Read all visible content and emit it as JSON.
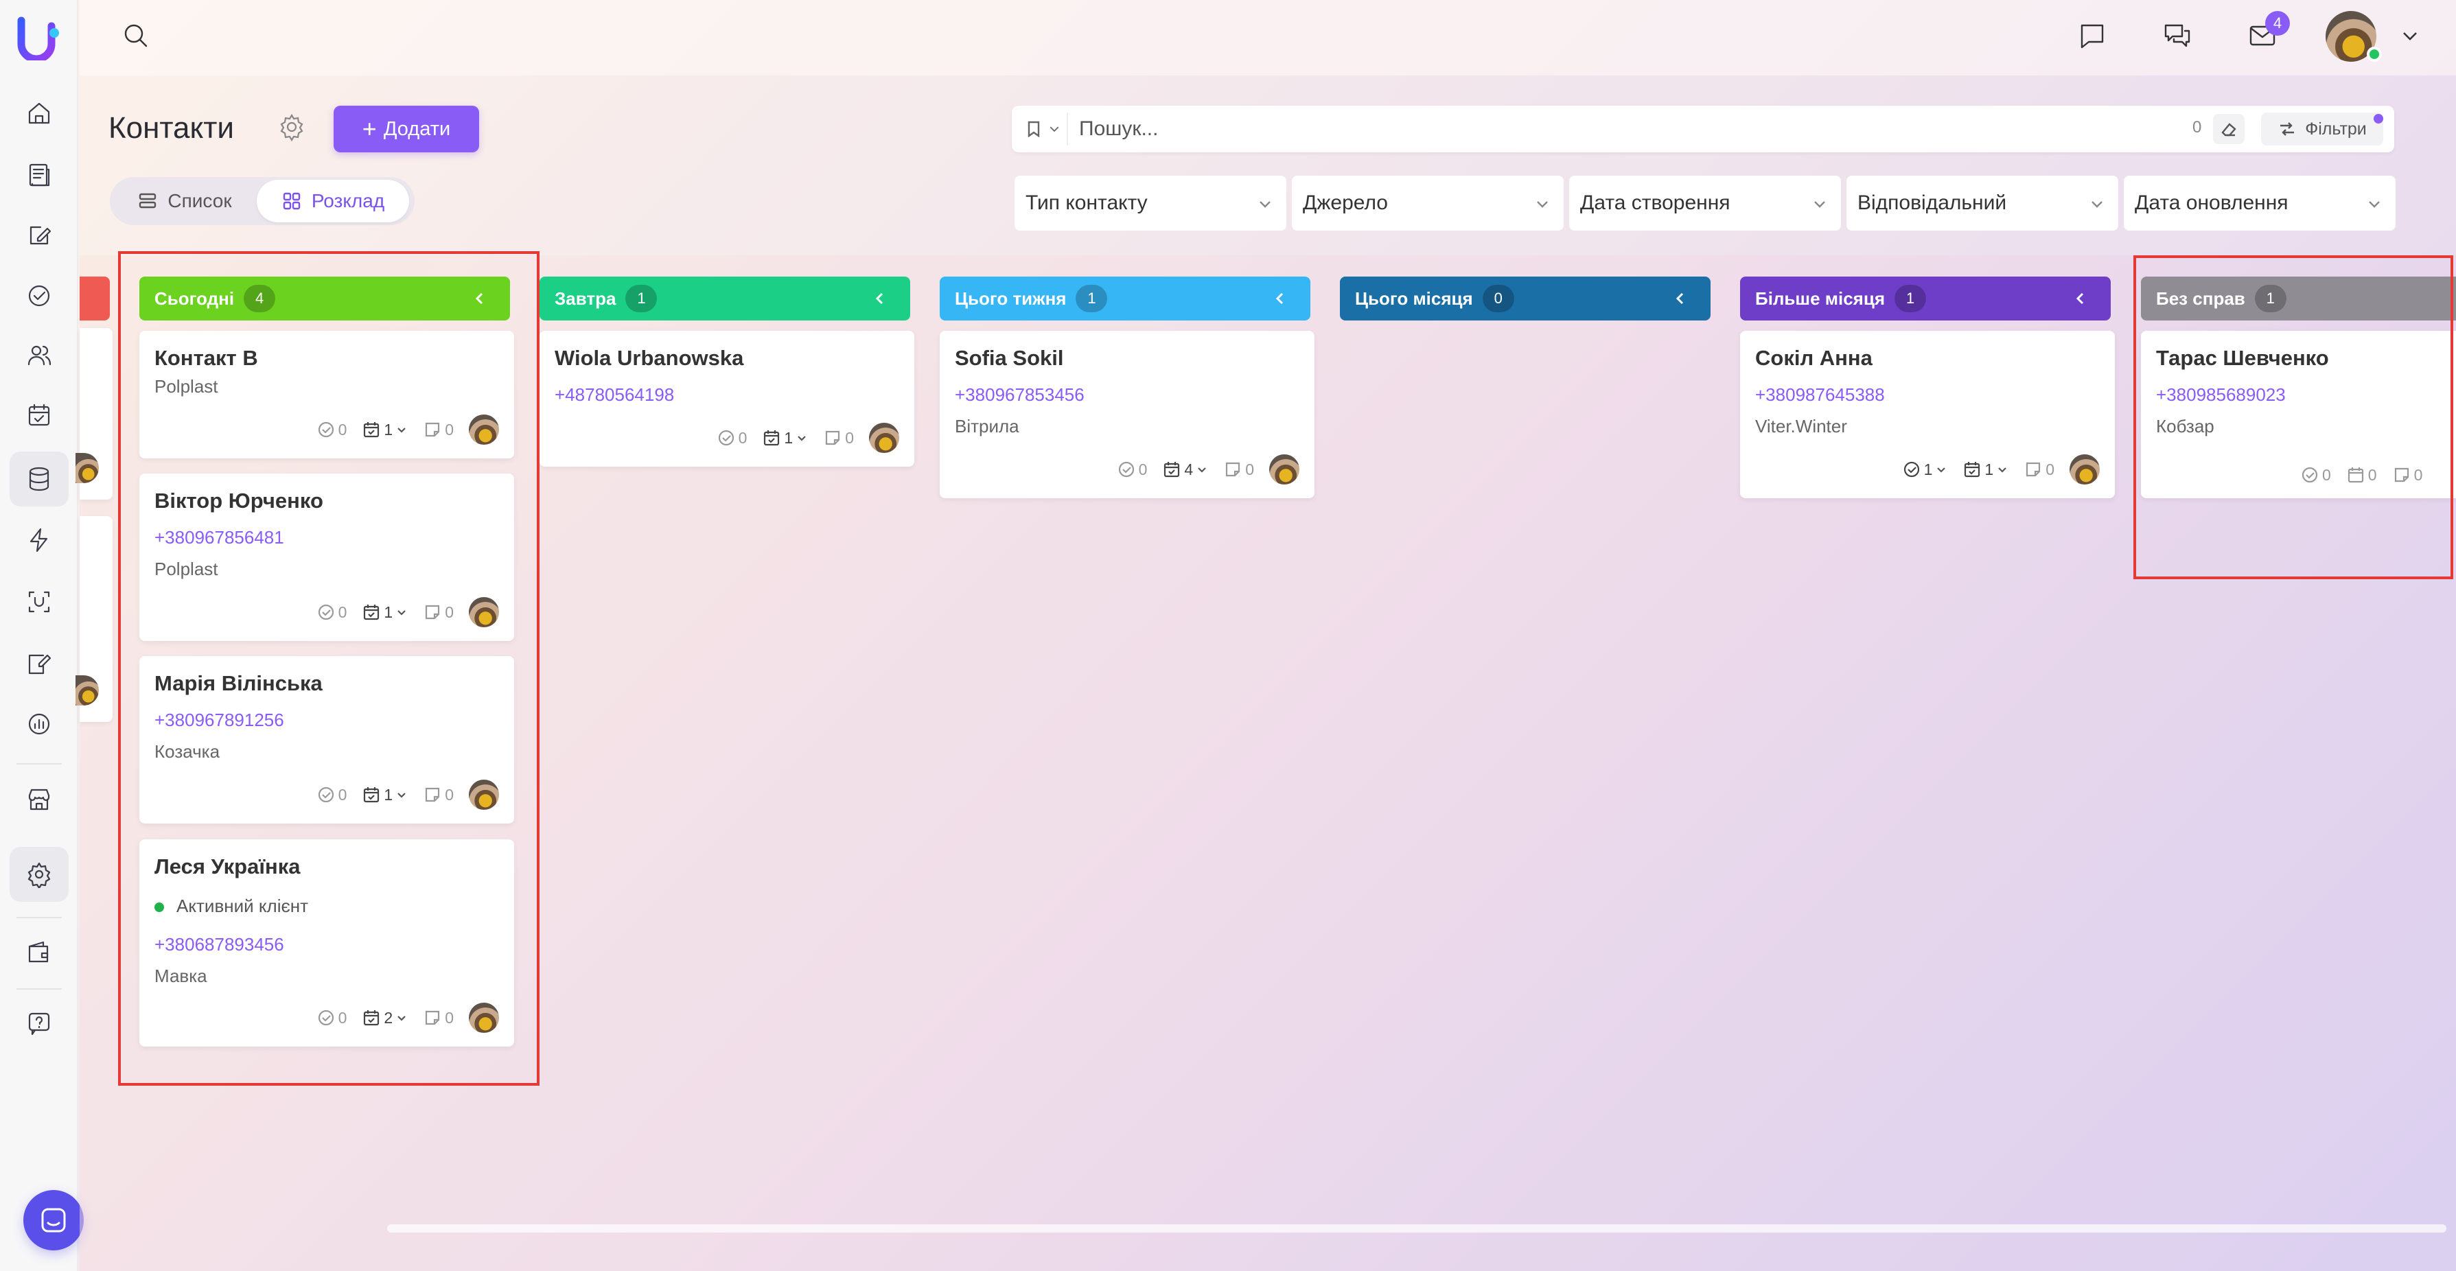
{
  "app": {
    "name": "Контакти"
  },
  "topbar": {
    "mail_badge": "4"
  },
  "page": {
    "title": "Контакти",
    "add_label": "Додати",
    "views": {
      "list": "Список",
      "board": "Розклад"
    }
  },
  "search": {
    "placeholder": "Пошук...",
    "count": "0",
    "filters_label": "Фільтри"
  },
  "filters": [
    "Тип контакту",
    "Джерело",
    "Дата створення",
    "Відповідальний",
    "Дата оновлення"
  ],
  "columns": [
    {
      "title": "Сьогодні",
      "count": "4",
      "color": "#6bd21f",
      "cards": [
        {
          "name": "Контакт В",
          "company": "Polplast",
          "tasks": "0",
          "events": "1",
          "notes": "0"
        },
        {
          "name": "Віктор Юрченко",
          "phone": "+380967856481",
          "company": "Polplast",
          "tasks": "0",
          "events": "1",
          "notes": "0"
        },
        {
          "name": "Марія Вілінська",
          "phone": "+380967891256",
          "company": "Козачка",
          "tasks": "0",
          "events": "1",
          "notes": "0"
        },
        {
          "name": "Леся Українка",
          "status": "Активний клієнт",
          "phone": "+380687893456",
          "company": "Мавка",
          "tasks": "0",
          "events": "2",
          "notes": "0"
        }
      ]
    },
    {
      "title": "Завтра",
      "count": "1",
      "color": "#1ccf86",
      "cards": [
        {
          "name": "Wiola Urbanowska",
          "phone": "+48780564198",
          "tasks": "0",
          "events": "1",
          "notes": "0"
        }
      ]
    },
    {
      "title": "Цього тижня",
      "count": "1",
      "color": "#37b6f6",
      "cards": [
        {
          "name": "Sofia Sokil",
          "phone": "+380967853456",
          "company": "Вітрила",
          "tasks": "0",
          "events": "4",
          "notes": "0"
        }
      ]
    },
    {
      "title": "Цього місяця",
      "count": "0",
      "color": "#1a6fa6",
      "cards": []
    },
    {
      "title": "Більше місяця",
      "count": "1",
      "color": "#6e3ec9",
      "cards": [
        {
          "name": "Сокіл Анна",
          "phone": "+380987645388",
          "company": "Viter.Winter",
          "tasks": "1",
          "events": "1",
          "notes": "0"
        }
      ]
    },
    {
      "title": "Без справ",
      "count": "1",
      "color": "#8f8c93",
      "cards": [
        {
          "name": "Тарас Шевченко",
          "phone": "+380985689023",
          "company": "Кобзар",
          "tasks": "0",
          "events": "0",
          "notes": "0"
        }
      ]
    }
  ],
  "colors": {
    "accent": "#8a5cf6",
    "highlight": "#e53935",
    "overdue": "#ef5b52"
  }
}
